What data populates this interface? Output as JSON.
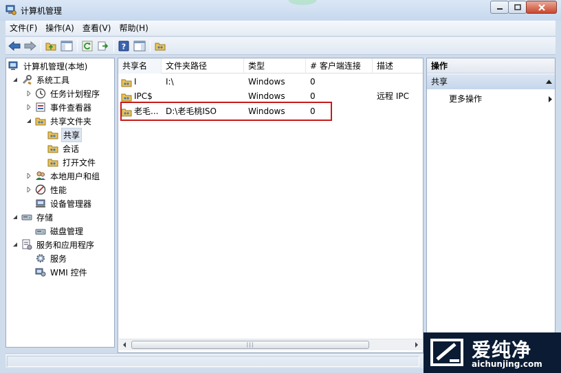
{
  "window": {
    "title": "计算机管理"
  },
  "menu": [
    "文件(F)",
    "操作(A)",
    "查看(V)",
    "帮助(H)"
  ],
  "toolbar": [
    "back-icon",
    "forward-icon",
    "up-folder-icon",
    "show-hide-tree-icon",
    "refresh-icon",
    "export-icon",
    "help-icon",
    "properties-icon",
    "share-icon"
  ],
  "tree": {
    "root": "计算机管理(本地)",
    "system_tools": "系统工具",
    "task_scheduler": "任务计划程序",
    "event_viewer": "事件查看器",
    "shared_folders": "共享文件夹",
    "shares": "共享",
    "sessions": "会话",
    "open_files": "打开文件",
    "local_users": "本地用户和组",
    "performance": "性能",
    "device_manager": "设备管理器",
    "storage": "存储",
    "disk_management": "磁盘管理",
    "services_apps": "服务和应用程序",
    "services": "服务",
    "wmi": "WMI 控件"
  },
  "list": {
    "columns": [
      "共享名",
      "文件夹路径",
      "类型",
      "# 客户端连接",
      "描述"
    ],
    "rows": [
      {
        "name": "I",
        "path": "I:\\",
        "type": "Windows",
        "clients": "0",
        "desc": ""
      },
      {
        "name": "IPC$",
        "path": "",
        "type": "Windows",
        "clients": "0",
        "desc": "远程 IPC"
      },
      {
        "name": "老毛...",
        "path": "D:\\老毛桃ISO",
        "type": "Windows",
        "clients": "0",
        "desc": ""
      }
    ]
  },
  "actions": {
    "title": "操作",
    "section": "共享",
    "more": "更多操作"
  },
  "watermark": {
    "brand": "爱纯净",
    "url": "aichunjing.com"
  }
}
